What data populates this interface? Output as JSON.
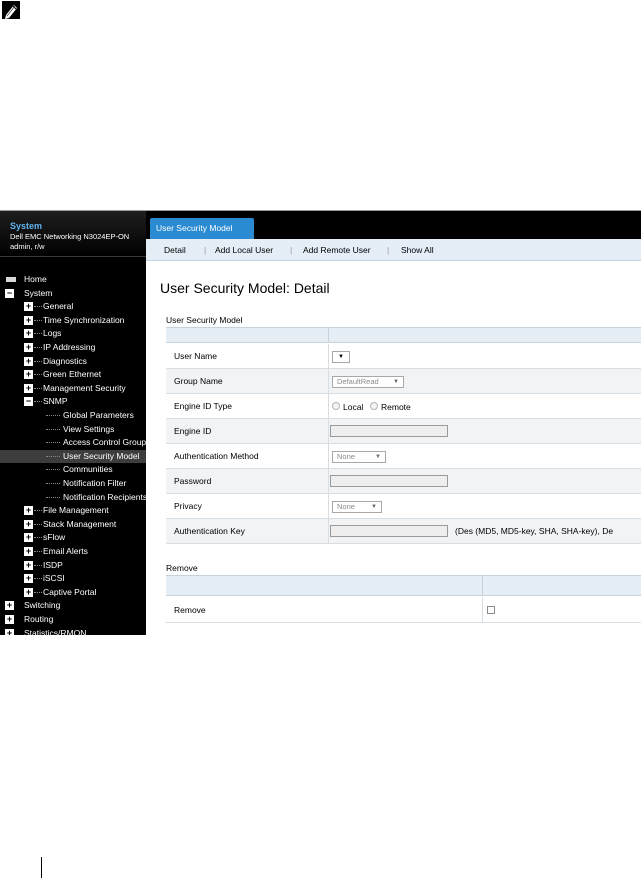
{
  "sidebar": {
    "header": {
      "title": "System",
      "device": "Dell EMC Networking N3024EP-ON",
      "user": "admin, r/w"
    },
    "tree": [
      {
        "label": "Home",
        "expander": "bar"
      },
      {
        "label": "System",
        "expander": "−"
      },
      {
        "label": "General",
        "expander": "+"
      },
      {
        "label": "Time Synchronization",
        "expander": "+"
      },
      {
        "label": "Logs",
        "expander": "+"
      },
      {
        "label": "IP Addressing",
        "expander": "+"
      },
      {
        "label": "Diagnostics",
        "expander": "+"
      },
      {
        "label": "Green Ethernet",
        "expander": "+"
      },
      {
        "label": "Management Security",
        "expander": "+"
      },
      {
        "label": "SNMP",
        "expander": "−"
      },
      {
        "label": "Global Parameters"
      },
      {
        "label": "View Settings"
      },
      {
        "label": "Access Control Group"
      },
      {
        "label": "User Security Model",
        "selected": true
      },
      {
        "label": "Communities"
      },
      {
        "label": "Notification Filter"
      },
      {
        "label": "Notification Recipients"
      },
      {
        "label": "File Management",
        "expander": "+"
      },
      {
        "label": "Stack Management",
        "expander": "+"
      },
      {
        "label": "sFlow",
        "expander": "+"
      },
      {
        "label": "Email Alerts",
        "expander": "+"
      },
      {
        "label": "ISDP",
        "expander": "+"
      },
      {
        "label": "iSCSI",
        "expander": "+"
      },
      {
        "label": "Captive Portal",
        "expander": "+"
      },
      {
        "label": "Switching",
        "expander": "+"
      },
      {
        "label": "Routing",
        "expander": "+"
      },
      {
        "label": "Statistics/RMON",
        "expander": "+"
      }
    ]
  },
  "main": {
    "tab": "User Security Model",
    "subnav": [
      "Detail",
      "Add Local User",
      "Add Remote User",
      "Show All"
    ],
    "page_title": "User Security Model: Detail",
    "usm_section": {
      "title": "User Security Model",
      "rows": [
        {
          "label": "User Name",
          "control": "select",
          "value": ""
        },
        {
          "label": "Group Name",
          "control": "select",
          "value": "DefaultRead"
        },
        {
          "label": "Engine ID Type",
          "control": "radio",
          "options": [
            "Local",
            "Remote"
          ]
        },
        {
          "label": "Engine ID",
          "control": "text"
        },
        {
          "label": "Authentication Method",
          "control": "select",
          "value": "None"
        },
        {
          "label": "Password",
          "control": "text"
        },
        {
          "label": "Privacy",
          "control": "select",
          "value": "None"
        },
        {
          "label": "Authentication Key",
          "control": "text",
          "note": "(Des (MD5, MD5-key, SHA, SHA-key), De"
        }
      ]
    },
    "remove_section": {
      "title": "Remove",
      "row_label": "Remove",
      "checked": false
    }
  },
  "colors": {
    "sidebar_bg": "#000000",
    "sidebar_title": "#5fb4ee",
    "tab_active": "#2a8bd3",
    "subnav_bg": "#e5eef7",
    "row_alt": "#f1f3f5"
  },
  "icons": {
    "note": "pencil-note-icon"
  }
}
